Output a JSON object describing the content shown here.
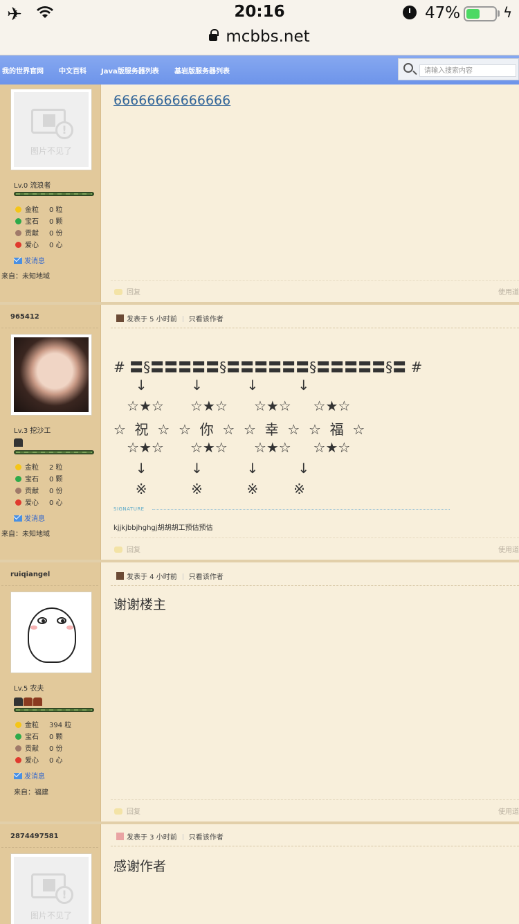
{
  "status_bar": {
    "time": "20:16",
    "battery_pct": "47%",
    "battery_level": 0.47
  },
  "url_bar": {
    "domain": "mcbbs.net"
  },
  "nav": {
    "links": [
      "我的世界官网",
      "中文百科",
      "Java版服务器列表",
      "基岩版服务器列表"
    ],
    "search_placeholder": "请输入搜索内容"
  },
  "common": {
    "stats_labels": [
      "金粒",
      "宝石",
      "贡献",
      "爱心"
    ],
    "send_message": "发消息",
    "reply": "回复",
    "use_hint": "使用道",
    "only_author": "只看该作者",
    "avatar_missing": "图片不见了"
  },
  "posts": [
    {
      "username": "",
      "level": "Lv.0 流浪者",
      "stats": [
        "0 粒",
        "0 颗",
        "0 份",
        "0 心"
      ],
      "from": "来自：未知地域",
      "link_text": "66666666666666"
    },
    {
      "username": "965412",
      "posted": "发表于 5 小时前",
      "level": "Lv.3 挖沙工",
      "stats": [
        "2 粒",
        "0 颗",
        "0 份",
        "0 心"
      ],
      "from": "来自：未知地域",
      "art": [
        "# 〓§〓〓〓〓〓§〓〓〓〓〓〓§〓〓〓〓〓§〓 #",
        "     ↓          ↓          ↓         ↓",
        "   ☆★☆      ☆★☆      ☆★☆     ☆★☆",
        "☆  祝  ☆  ☆  你  ☆  ☆  幸  ☆  ☆  福  ☆",
        "   ☆★☆      ☆★☆      ☆★☆     ☆★☆",
        "     ↓          ↓          ↓         ↓",
        "     ※          ※          ※        ※"
      ],
      "signature_label": "SIGNATURE",
      "signature": "kjjkjbbjhghgj胡胡胡工预估预估"
    },
    {
      "username": "ruiqiangel",
      "posted": "发表于 4 小时前",
      "level": "Lv.5 农夫",
      "stats": [
        "394 粒",
        "0 颗",
        "0 份",
        "0 心"
      ],
      "from": "来自：福建",
      "body": "谢谢楼主"
    },
    {
      "username": "2874497581",
      "posted": "发表于 3 小时前",
      "body": "感谢作者"
    }
  ],
  "colors": {
    "nav_blue": "#6d94ea",
    "sidebar": "#e2c99b",
    "content_bg": "#f8efdb",
    "link": "#336699",
    "stat_gold": "#f5c518",
    "stat_gem": "#2eaa4a",
    "stat_contrib": "#a07a6a",
    "stat_love": "#e03a2e"
  }
}
